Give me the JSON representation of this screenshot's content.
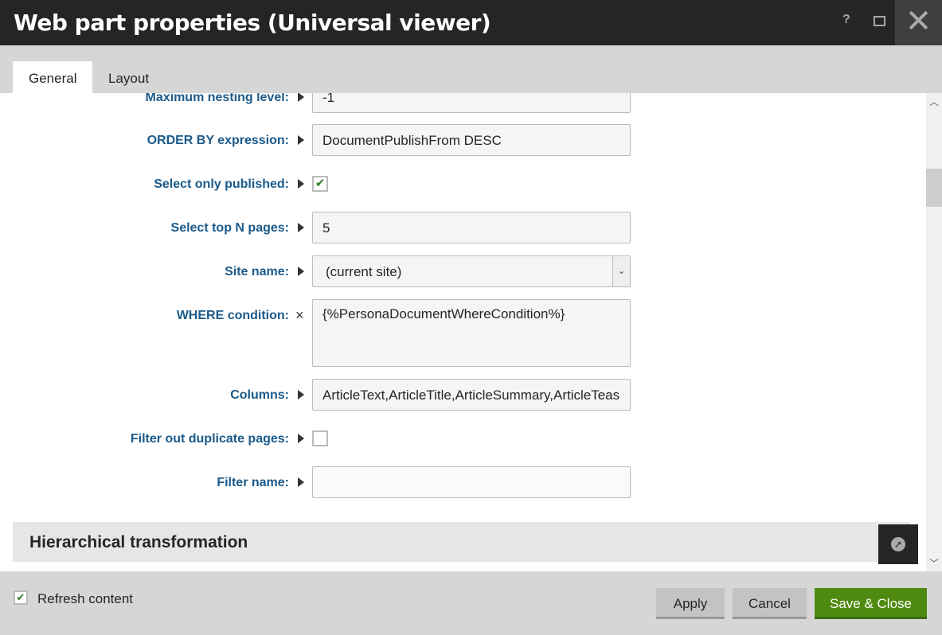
{
  "window": {
    "title": "Web part properties (Universal viewer)",
    "help": "?",
    "close": "✕"
  },
  "tabs": [
    {
      "label": "General",
      "active": true
    },
    {
      "label": "Layout",
      "active": false
    }
  ],
  "fields": [
    {
      "label": "Maximum nesting level:",
      "value": "-1",
      "type": "text"
    },
    {
      "label": "ORDER BY expression:",
      "value": "DocumentPublishFrom DESC",
      "type": "text"
    },
    {
      "label": "Select only published:",
      "checked": true,
      "type": "checkbox"
    },
    {
      "label": "Select top N pages:",
      "value": "5",
      "type": "text"
    },
    {
      "label": "Site name:",
      "value": "(current site)",
      "type": "select"
    },
    {
      "label": "WHERE condition:",
      "value": "{%PersonaDocumentWhereCondition%}",
      "type": "textarea"
    },
    {
      "label": "Columns:",
      "value": "ArticleText,ArticleTitle,ArticleSummary,ArticleTeas",
      "type": "text"
    },
    {
      "label": "Filter out duplicate pages:",
      "checked": false,
      "type": "checkbox"
    },
    {
      "label": "Filter name:",
      "value": "",
      "type": "text"
    }
  ],
  "section": {
    "title": "Hierarchical transformation"
  },
  "footer": {
    "refresh_label": "Refresh content",
    "refresh_checked": true,
    "apply": "Apply",
    "cancel": "Cancel",
    "save_close": "Save & Close"
  },
  "colors": {
    "label": "#1b5a8a",
    "save": "#4f8a10",
    "titlebar": "#262523"
  }
}
